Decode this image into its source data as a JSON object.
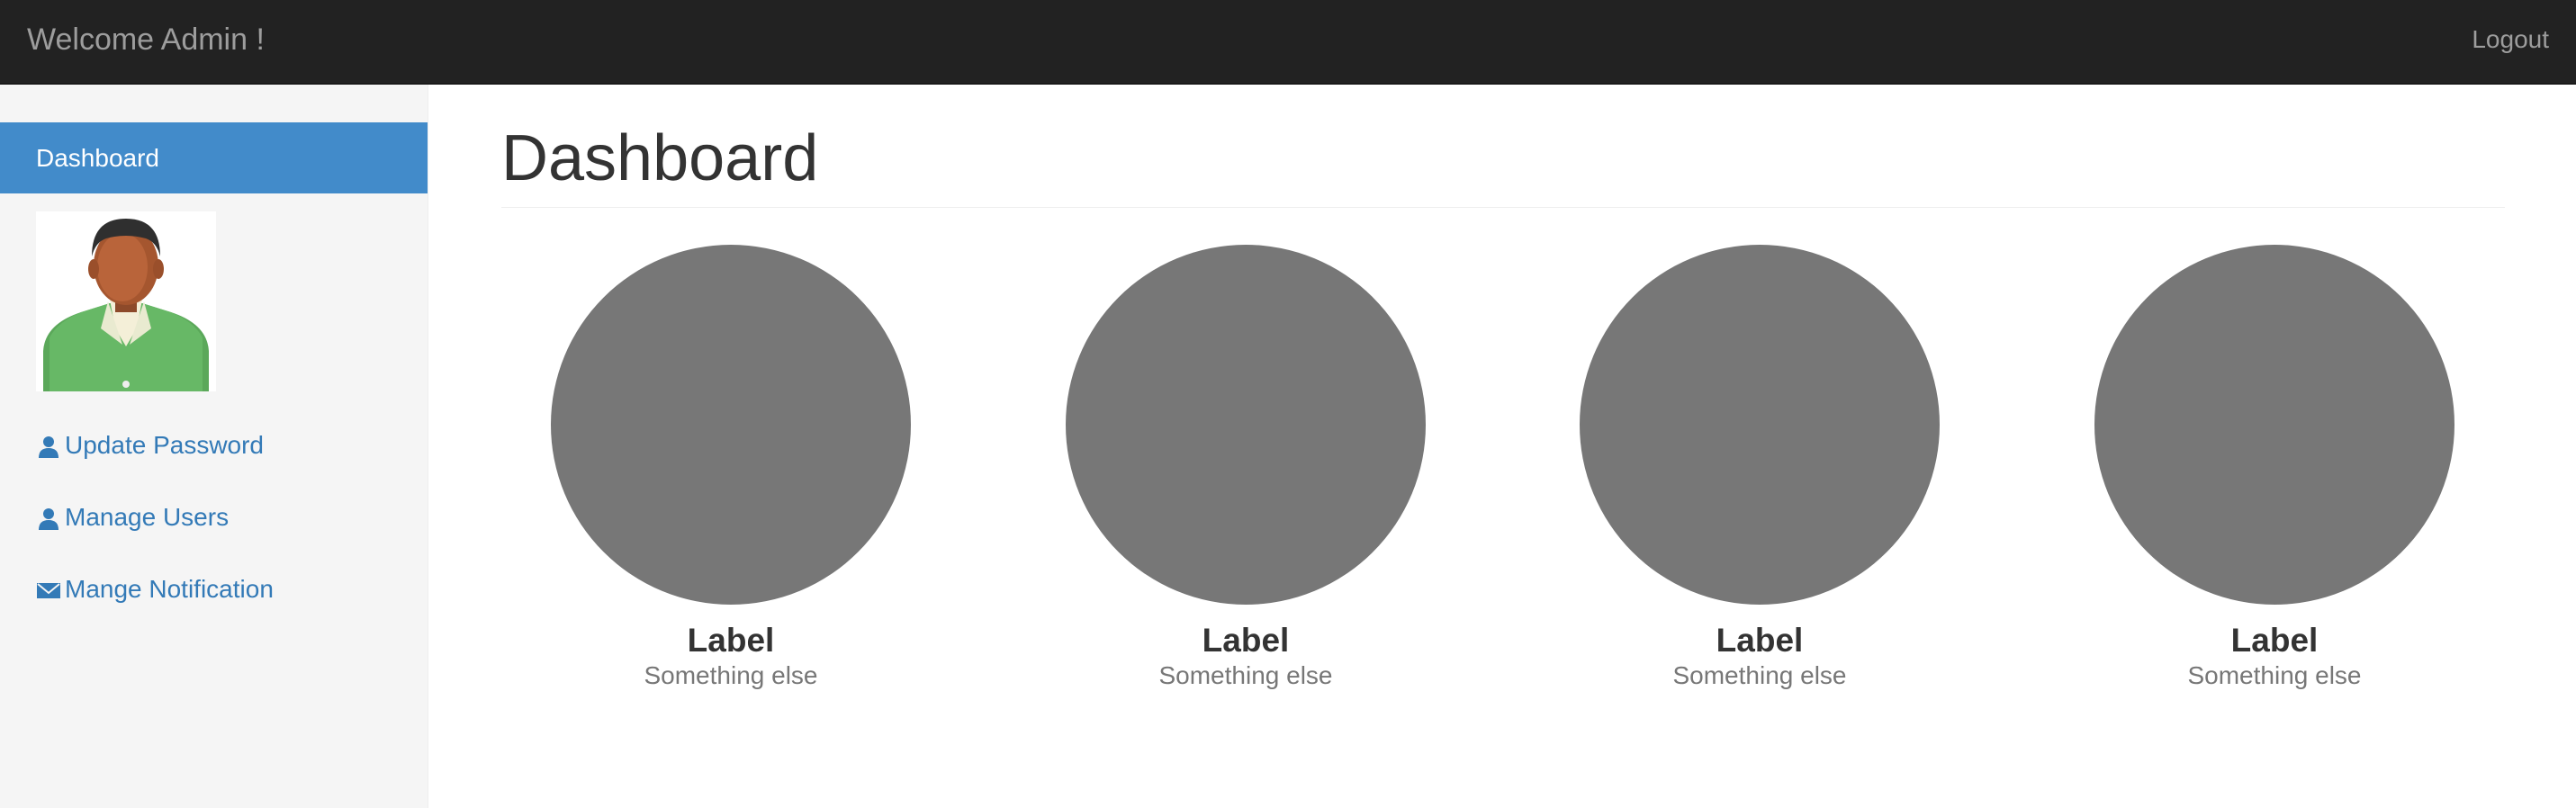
{
  "navbar": {
    "brand": "Welcome Admin !",
    "logout": "Logout",
    "background": "#222222",
    "text_color": "#9d9d9d"
  },
  "sidebar": {
    "active_item": "Dashboard",
    "active_color": "#428bca",
    "avatar_icon": "user-avatar-image",
    "links": [
      {
        "label": "Update Password",
        "icon": "user-icon"
      },
      {
        "label": "Manage Users",
        "icon": "user-icon"
      },
      {
        "label": "Mange Notification",
        "icon": "envelope-icon"
      }
    ]
  },
  "main": {
    "title": "Dashboard",
    "placeholders": [
      {
        "label": "Label",
        "sub": "Something else"
      },
      {
        "label": "Label",
        "sub": "Something else"
      },
      {
        "label": "Label",
        "sub": "Something else"
      },
      {
        "label": "Label",
        "sub": "Something else"
      }
    ],
    "circle_color": "#777777"
  }
}
